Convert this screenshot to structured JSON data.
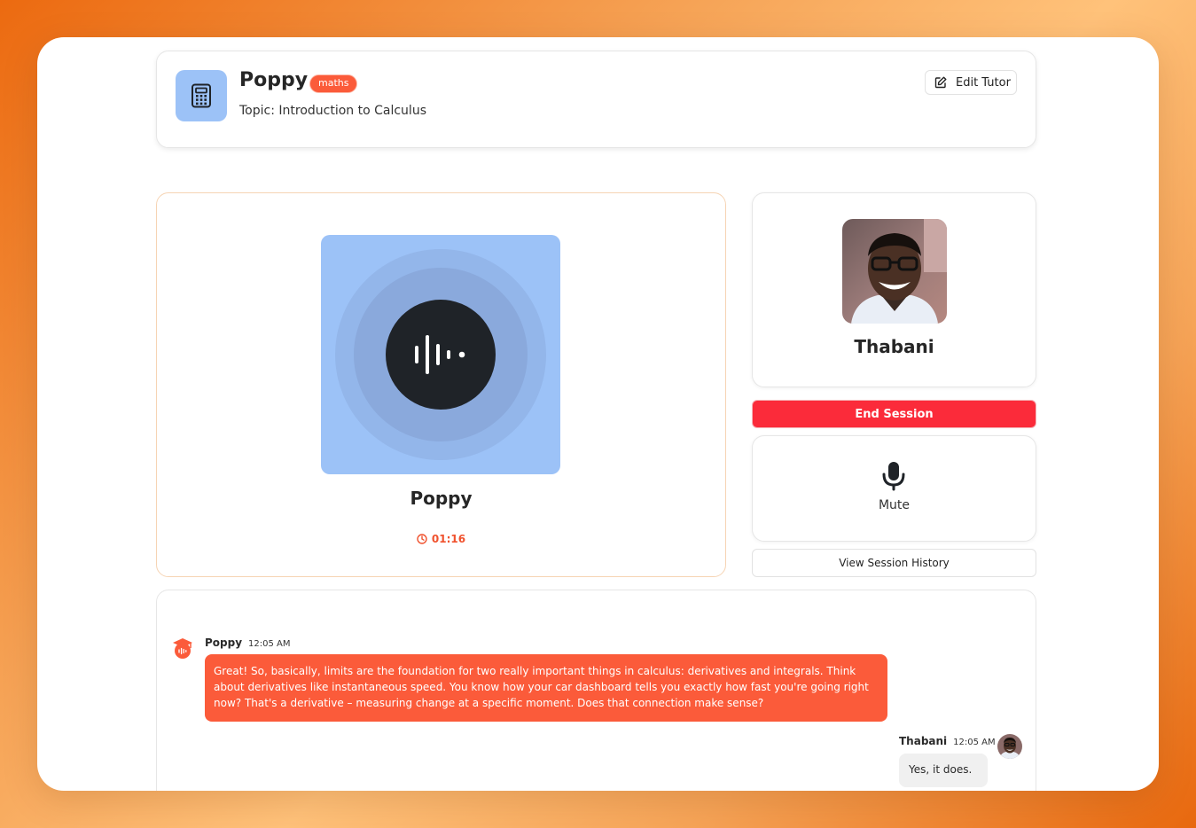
{
  "header": {
    "tutor_name": "Poppy",
    "subject_badge": "maths",
    "topic": "Topic: Introduction to Calculus",
    "edit_label": "Edit Tutor",
    "icon": "calculator-icon"
  },
  "session": {
    "companion_name": "Poppy",
    "timer": "01:16",
    "user_name": "Thabani",
    "end_label": "End Session",
    "mute_label": "Mute",
    "history_label": "View Session History"
  },
  "messages": [
    {
      "sender": "Poppy",
      "time": "12:05 AM",
      "text": "Great! So, basically, limits are the foundation for two really important things in calculus: derivatives and integrals. Think about derivatives like instantaneous speed. You know how your car dashboard tells you exactly how fast you're going right now? That's a derivative – measuring change at a specific moment. Does that connection make sense?"
    },
    {
      "sender": "Thabani",
      "time": "12:05 AM",
      "text": "Yes, it does."
    }
  ],
  "colors": {
    "accent": "#fb5b3a",
    "danger": "#fb2b3a",
    "tile": "#9cc2f7"
  }
}
